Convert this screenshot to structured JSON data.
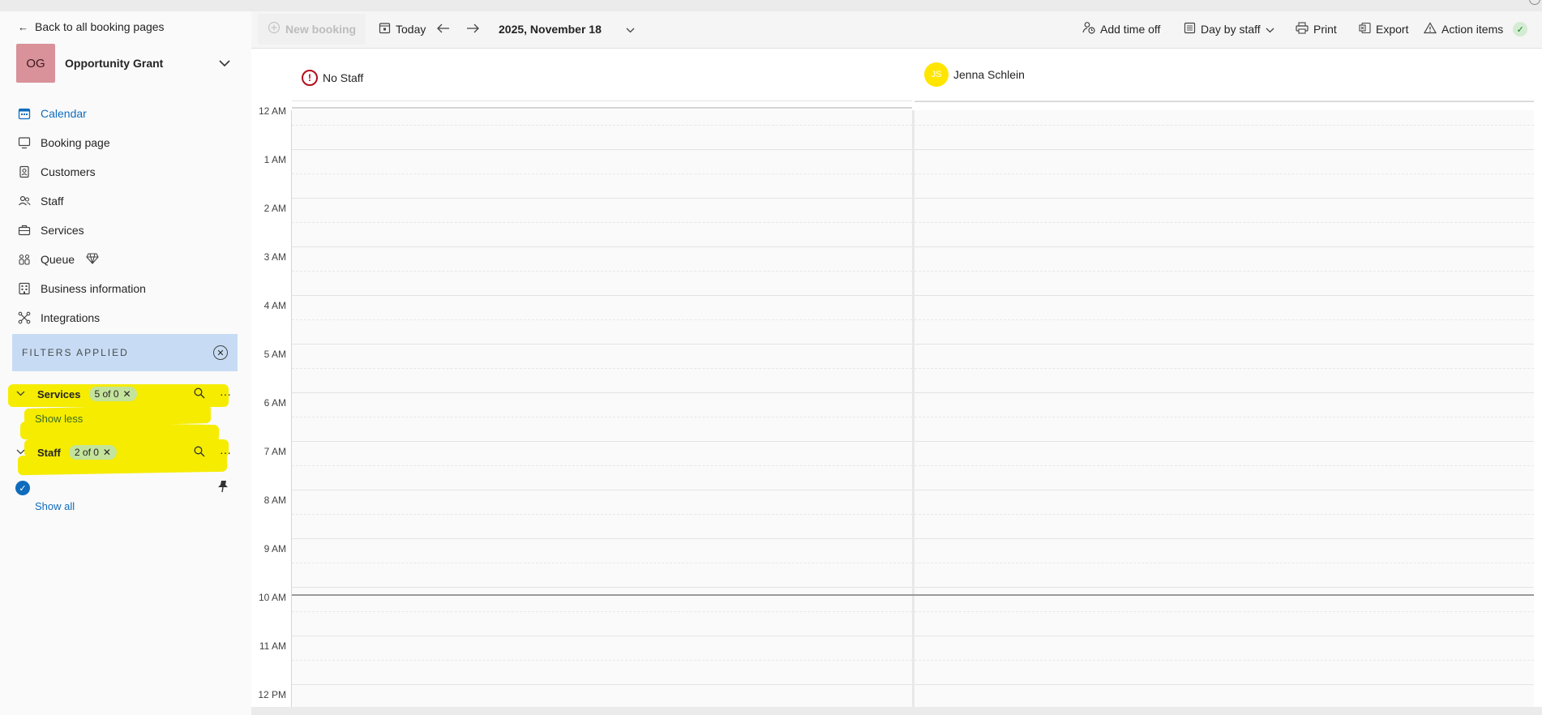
{
  "sidebar": {
    "back_link": "Back to all booking pages",
    "business": {
      "initials": "OG",
      "name": "Opportunity Grant"
    },
    "nav": [
      {
        "label": "Calendar",
        "icon": "calendar-icon"
      },
      {
        "label": "Booking page",
        "icon": "monitor-icon"
      },
      {
        "label": "Customers",
        "icon": "contact-card-icon"
      },
      {
        "label": "Staff",
        "icon": "people-icon"
      },
      {
        "label": "Services",
        "icon": "briefcase-icon"
      },
      {
        "label": "Queue",
        "icon": "queue-icon"
      },
      {
        "label": "Business information",
        "icon": "building-icon"
      },
      {
        "label": "Integrations",
        "icon": "integrations-icon"
      }
    ],
    "filters": {
      "header": "FILTERS APPLIED",
      "services": {
        "title": "Services",
        "count": "5 of 0"
      },
      "show_less": "Show less",
      "staff": {
        "title": "Staff",
        "count": "2 of 0"
      },
      "show_all": "Show all"
    }
  },
  "toolbar": {
    "new_booking": "New booking",
    "today": "Today",
    "date": "2025, November 18",
    "add_time_off": "Add time off",
    "view": "Day by staff",
    "print": "Print",
    "export": "Export",
    "action_items": "Action items"
  },
  "calendar": {
    "columns": [
      {
        "name": "No Staff"
      },
      {
        "name": "Jenna Schlein",
        "initials": "JS"
      }
    ],
    "hours": [
      "12 AM",
      "1 AM",
      "2 AM",
      "3 AM",
      "4 AM",
      "5 AM",
      "6 AM",
      "7 AM",
      "8 AM",
      "9 AM",
      "10 AM",
      "11 AM",
      "12 PM"
    ]
  },
  "colors": {
    "accent": "#0f6cbd",
    "avatar_og": "#d9919a",
    "avatar_js": "#ffe500",
    "filter_bar": "#c7dcf4",
    "highlight": "#f5ec00",
    "pill": "#c4e39b",
    "warning": "#b10e1c"
  }
}
